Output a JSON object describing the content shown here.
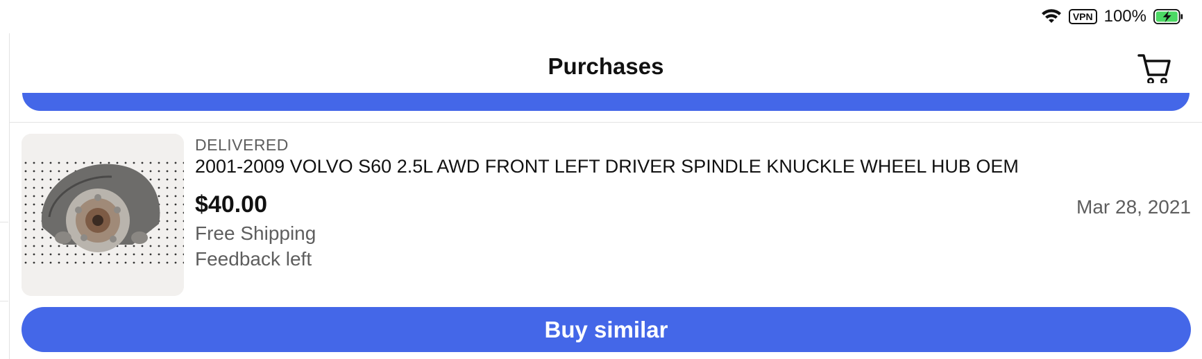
{
  "status_bar": {
    "wifi_icon": "wifi-icon",
    "vpn_label": "VPN",
    "battery_percent": "100%",
    "battery_icon": "battery-charging-icon",
    "battery_color": "#4cd964"
  },
  "nav": {
    "title": "Purchases",
    "cart_icon": "cart-icon"
  },
  "accent_color": "#4467e8",
  "purchase": {
    "status": "DELIVERED",
    "title": "2001-2009 VOLVO S60 2.5L AWD FRONT LEFT DRIVER SPINDLE KNUCKLE WHEEL HUB OEM",
    "price": "$40.00",
    "shipping": "Free Shipping",
    "feedback": "Feedback left",
    "date": "Mar 28, 2021",
    "image_icon": "wheel-hub-photo"
  },
  "actions": {
    "buy_similar": "Buy similar"
  }
}
